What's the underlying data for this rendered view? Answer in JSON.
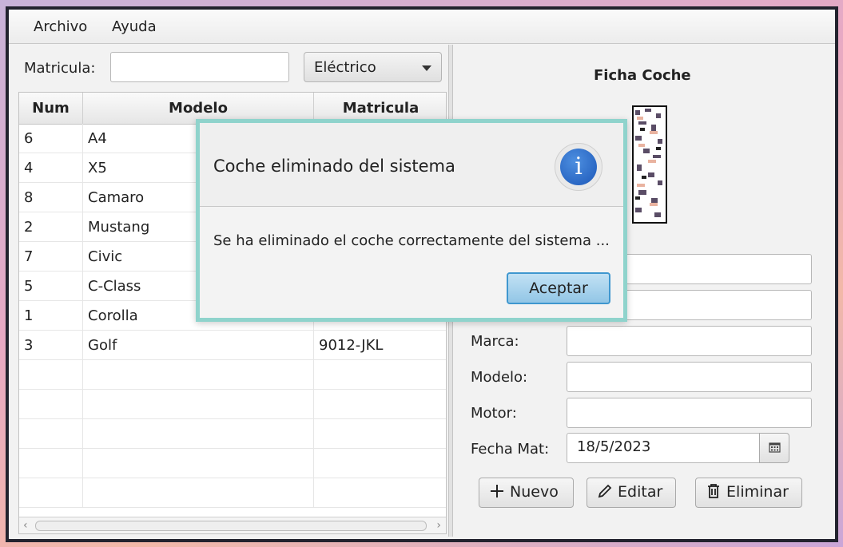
{
  "menu": {
    "archivo": "Archivo",
    "ayuda": "Ayuda"
  },
  "filter": {
    "label": "Matricula:",
    "value": "",
    "combo": "Eléctrico"
  },
  "table": {
    "headers": [
      "Num",
      "Modelo",
      "Matricula"
    ],
    "rows": [
      [
        "6",
        "A4",
        ""
      ],
      [
        "4",
        "X5",
        ""
      ],
      [
        "8",
        "Camaro",
        ""
      ],
      [
        "2",
        "Mustang",
        ""
      ],
      [
        "7",
        "Civic",
        ""
      ],
      [
        "5",
        "C-Class",
        ""
      ],
      [
        "1",
        "Corolla",
        ""
      ],
      [
        "3",
        "Golf",
        "9012-JKL"
      ]
    ]
  },
  "form": {
    "title": "Ficha Coche",
    "marca_label": "Marca:",
    "modelo_label": "Modelo:",
    "motor_label": "Motor:",
    "fecha_label": "Fecha Mat:",
    "fecha_value": "18/5/2023"
  },
  "buttons": {
    "nuevo": "Nuevo",
    "editar": "Editar",
    "eliminar": "Eliminar"
  },
  "dialog": {
    "header": "Coche eliminado del sistema",
    "message": "Se ha eliminado el coche correctamente del sistema ...",
    "accept": "Aceptar"
  },
  "icons": {
    "dialog": "info-icon",
    "nuevo": "plus-icon",
    "editar": "pencil-icon",
    "eliminar": "trash-icon",
    "fecha": "calendar-icon",
    "combo": "chevron-down-icon"
  },
  "colors": {
    "dialog_border": "#8fd3cc",
    "accept_border": "#3f97cf",
    "info_blue": "#1c57b8"
  }
}
